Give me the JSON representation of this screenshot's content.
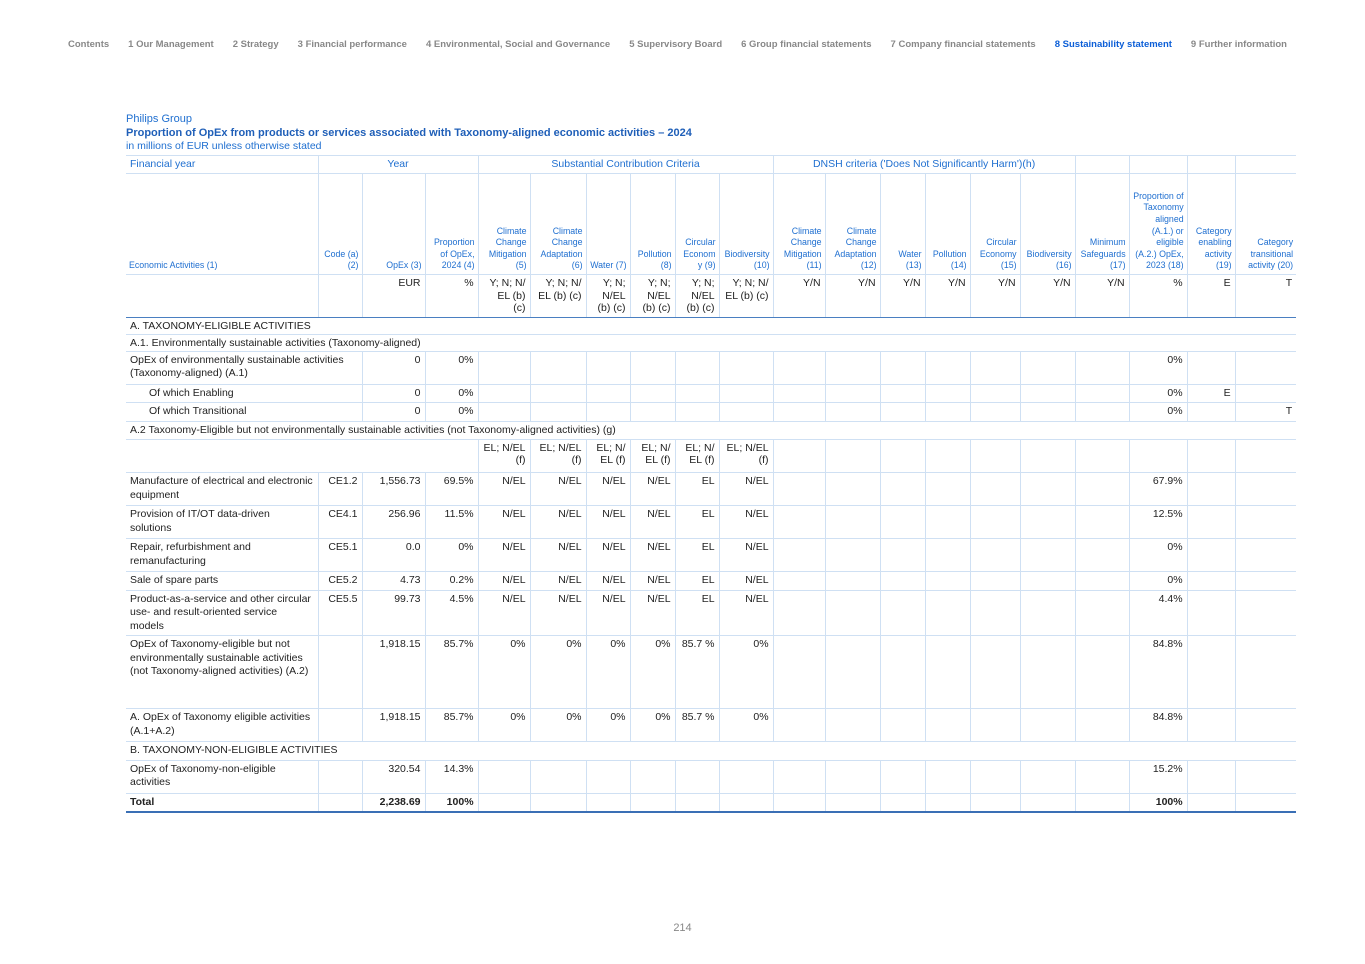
{
  "nav": [
    {
      "label": "Contents",
      "active": false
    },
    {
      "label": "1 Our Management",
      "active": false
    },
    {
      "label": "2 Strategy",
      "active": false
    },
    {
      "label": "3 Financial performance",
      "active": false
    },
    {
      "label": "4 Environmental, Social and Governance",
      "active": false
    },
    {
      "label": "5 Supervisory Board",
      "active": false
    },
    {
      "label": "6 Group financial statements",
      "active": false
    },
    {
      "label": "7 Company financial statements",
      "active": false
    },
    {
      "label": "8 Sustainability statement",
      "active": true
    },
    {
      "label": "9 Further information",
      "active": false
    }
  ],
  "header": {
    "group": "Philips Group",
    "title": "Proportion of OpEx from products or services associated with Taxonomy-aligned economic activities – 2024",
    "subtitle": "in millions of EUR unless otherwise stated"
  },
  "table": {
    "group_headers": {
      "financial_year": "Financial year",
      "year": "Year",
      "scc": "Substantial Contribution Criteria",
      "dnsh": "DNSH criteria ('Does Not Significantly Harm')(h)"
    },
    "columns": [
      "Economic Activities (1)",
      "Code (a) (2)",
      "OpEx (3)",
      "Proportion of OpEx, 2024 (4)",
      "Climate Change Mitigation (5)",
      "Climate Change Adaptation (6)",
      "Water (7)",
      "Pollution (8)",
      "Circular Econom y (9)",
      "Biodiversity (10)",
      "Climate Change Mitigation (11)",
      "Climate Change Adaptation (12)",
      "Water (13)",
      "Pollution (14)",
      "Circular Economy (15)",
      "Biodiversity (16)",
      "Minimum Safeguards (17)",
      "Proportion of Taxonomy aligned (A.1.) or eligible (A.2.) OpEx, 2023 (18)",
      "Category enabling activity (19)",
      "Category transitional activity (20)"
    ],
    "units": [
      "",
      "",
      "EUR",
      "%",
      "Y; N; N/ EL (b) (c)",
      "Y; N; N/ EL (b) (c)",
      "Y; N; N/EL (b) (c)",
      "Y; N; N/EL (b) (c)",
      "Y; N; N/EL (b) (c)",
      "Y; N; N/ EL (b) (c)",
      "Y/N",
      "Y/N",
      "Y/N",
      "Y/N",
      "Y/N",
      "Y/N",
      "Y/N",
      "%",
      "E",
      "T"
    ],
    "sections": {
      "a": "A. TAXONOMY-ELIGIBLE ACTIVITIES",
      "a1": "A.1. Environmentally sustainable activities (Taxonomy-aligned)",
      "a2": "A.2 Taxonomy-Eligible but not environmentally sustainable activities (not Taxonomy-aligned activities) (g)",
      "b": "B. TAXONOMY-NON-ELIGIBLE ACTIVITIES"
    },
    "a1_rows": [
      {
        "label": "OpEx of environmentally sustainable activities (Taxonomy-aligned) (A.1)",
        "opex": "0",
        "prop": "0%",
        "prev": "0%",
        "e": "",
        "t": ""
      },
      {
        "label": "Of which Enabling",
        "opex": "0",
        "prop": "0%",
        "prev": "0%",
        "e": "E",
        "t": ""
      },
      {
        "label": "Of which Transitional",
        "opex": "0",
        "prop": "0%",
        "prev": "0%",
        "e": "",
        "t": "T"
      }
    ],
    "a2_units": [
      "EL; N/EL (f)",
      "EL; N/EL (f)",
      "EL; N/ EL (f)",
      "EL; N/ EL (f)",
      "EL; N/ EL (f)",
      "EL; N/EL (f)"
    ],
    "a2_rows": [
      {
        "label": "Manufacture of electrical and electronic equipment",
        "code": "CE1.2",
        "opex": "1,556.73",
        "prop": "69.5%",
        "c5": "N/EL",
        "c6": "N/EL",
        "c7": "N/EL",
        "c8": "N/EL",
        "c9": "EL",
        "c10": "N/EL",
        "prev": "67.9%"
      },
      {
        "label": "Provision of IT/OT data-driven solutions",
        "code": "CE4.1",
        "opex": "256.96",
        "prop": "11.5%",
        "c5": "N/EL",
        "c6": "N/EL",
        "c7": "N/EL",
        "c8": "N/EL",
        "c9": "EL",
        "c10": "N/EL",
        "prev": "12.5%"
      },
      {
        "label": "Repair, refurbishment and remanufacturing",
        "code": "CE5.1",
        "opex": "0.0",
        "prop": "0%",
        "c5": "N/EL",
        "c6": "N/EL",
        "c7": "N/EL",
        "c8": "N/EL",
        "c9": "EL",
        "c10": "N/EL",
        "prev": "0%"
      },
      {
        "label": "Sale of spare parts",
        "code": "CE5.2",
        "opex": "4.73",
        "prop": "0.2%",
        "c5": "N/EL",
        "c6": "N/EL",
        "c7": "N/EL",
        "c8": "N/EL",
        "c9": "EL",
        "c10": "N/EL",
        "prev": "0%"
      },
      {
        "label": "Product-as-a-service and other circular use- and result-oriented service models",
        "code": "CE5.5",
        "opex": "99.73",
        "prop": "4.5%",
        "c5": "N/EL",
        "c6": "N/EL",
        "c7": "N/EL",
        "c8": "N/EL",
        "c9": "EL",
        "c10": "N/EL",
        "prev": "4.4%"
      }
    ],
    "a2_total": {
      "label": "OpEx of Taxonomy-eligible but not environmentally sustainable activities (not Taxonomy-aligned activities) (A.2)",
      "opex": "1,918.15",
      "prop": "85.7%",
      "c5": "0%",
      "c6": "0%",
      "c7": "0%",
      "c8": "0%",
      "c9": "85.7 %",
      "c10": "0%",
      "prev": "84.8%"
    },
    "a_total": {
      "label": "A. OpEx of Taxonomy eligible activities (A.1+A.2)",
      "opex": "1,918.15",
      "prop": "85.7%",
      "c5": "0%",
      "c6": "0%",
      "c7": "0%",
      "c8": "0%",
      "c9": "85.7 %",
      "c10": "0%",
      "prev": "84.8%"
    },
    "b_row": {
      "label": "OpEx of Taxonomy-non-eligible activities",
      "opex": "320.54",
      "prop": "14.3%",
      "prev": "15.2%"
    },
    "total": {
      "label": "Total",
      "opex": "2,238.69",
      "prop": "100%",
      "prev": "100%"
    }
  },
  "page_number": "214"
}
